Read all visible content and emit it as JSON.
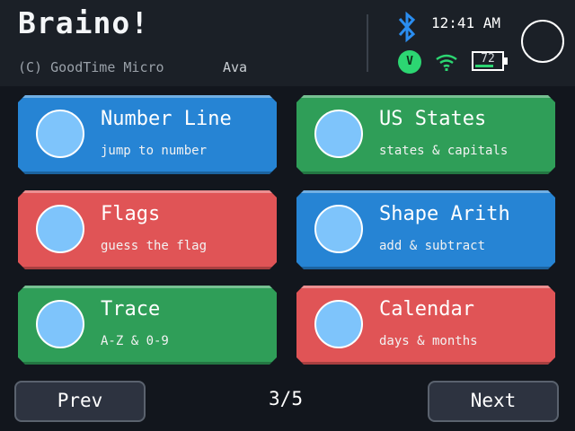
{
  "header": {
    "title": "Braino!",
    "copyright": "(C) GoodTime Micro",
    "user": "Ava",
    "time": "12:41 AM",
    "volume_badge": "V",
    "battery_percent": 72,
    "battery_label": "72",
    "icons": {
      "bluetooth": "bluetooth-icon",
      "wifi": "wifi-icon",
      "power": "power-circle-icon"
    },
    "colors": {
      "accent_green": "#2cd672",
      "bluetooth_blue": "#2a8df0"
    }
  },
  "cards": [
    {
      "title": "Number Line",
      "subtitle": "jump to number",
      "color": "#2684d4"
    },
    {
      "title": "US States",
      "subtitle": "states & capitals",
      "color": "#2f9e58"
    },
    {
      "title": "Flags",
      "subtitle": "guess the flag",
      "color": "#e05456"
    },
    {
      "title": "Shape Arith",
      "subtitle": "add & subtract",
      "color": "#2684d4"
    },
    {
      "title": "Trace",
      "subtitle": "A-Z & 0-9",
      "color": "#2f9e58"
    },
    {
      "title": "Calendar",
      "subtitle": "days & months",
      "color": "#e05456"
    }
  ],
  "pager": {
    "prev_label": "Prev",
    "next_label": "Next",
    "indicator": "3/5"
  }
}
